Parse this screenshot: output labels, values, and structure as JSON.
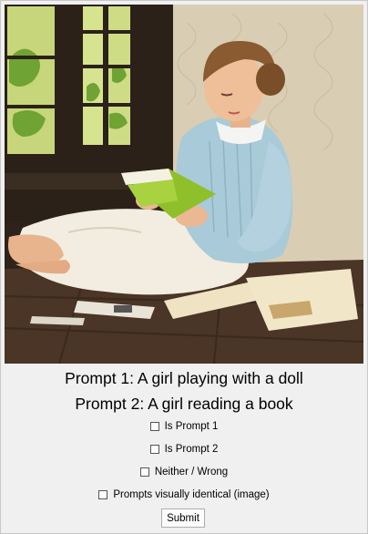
{
  "image": {
    "subject": "girl-reading-book-illustration",
    "colors": {
      "wall": "#d9cdb4",
      "floor": "#4a3526",
      "blouse": "#a9cad8",
      "skirt": "#f2ede0",
      "book": "#8fbf2a",
      "hair": "#8a5a30",
      "window_light": "#d8e59a"
    }
  },
  "prompts": {
    "prompt1": "Prompt 1: A girl playing with a doll",
    "prompt2": "Prompt 2: A girl reading a book"
  },
  "options": [
    {
      "label": "Is Prompt 1",
      "checked": false
    },
    {
      "label": "Is Prompt 2",
      "checked": false
    },
    {
      "label": "Neither / Wrong",
      "checked": false
    },
    {
      "label": "Prompts visually identical (image)",
      "checked": false
    }
  ],
  "submit_label": "Submit"
}
